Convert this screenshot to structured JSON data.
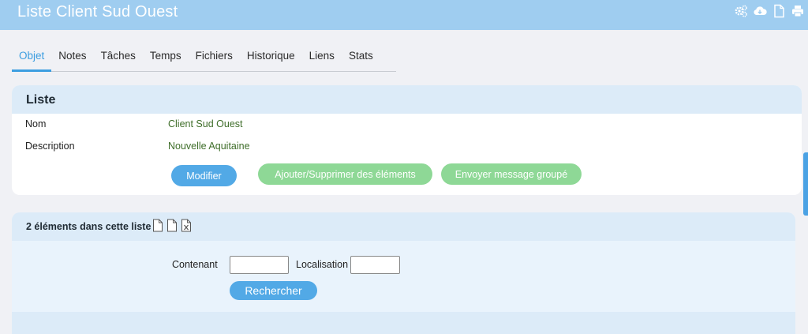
{
  "header": {
    "title": "Liste Client Sud Ouest",
    "icons": [
      "settings-icon",
      "cloud-download-icon",
      "document-icon",
      "print-icon"
    ]
  },
  "tabs": [
    {
      "label": "Objet",
      "active": true
    },
    {
      "label": "Notes",
      "active": false
    },
    {
      "label": "Tâches",
      "active": false
    },
    {
      "label": "Temps",
      "active": false
    },
    {
      "label": "Fichiers",
      "active": false
    },
    {
      "label": "Historique",
      "active": false
    },
    {
      "label": "Liens",
      "active": false
    },
    {
      "label": "Stats",
      "active": false
    }
  ],
  "list_card": {
    "title": "Liste",
    "fields": [
      {
        "label": "Nom",
        "value": "Client Sud Ouest"
      },
      {
        "label": "Description",
        "value": "Nouvelle Aquitaine"
      }
    ],
    "buttons": {
      "modify": "Modifier",
      "add_remove": "Ajouter/Supprimer des éléments",
      "group_message": "Envoyer message groupé"
    }
  },
  "elements_card": {
    "title": "2 éléments dans cette liste",
    "export_icons": [
      "file-icon",
      "file-icon",
      "excel-file-icon"
    ],
    "search": {
      "containing_label": "Contenant",
      "containing_value": "",
      "location_label": "Localisation",
      "location_value": "",
      "button": "Rechercher"
    }
  },
  "colors": {
    "header": "#9fcdf0",
    "accent_blue": "#52a9e6",
    "accent_green": "#8ed896",
    "value_text": "#3f6e2a"
  }
}
